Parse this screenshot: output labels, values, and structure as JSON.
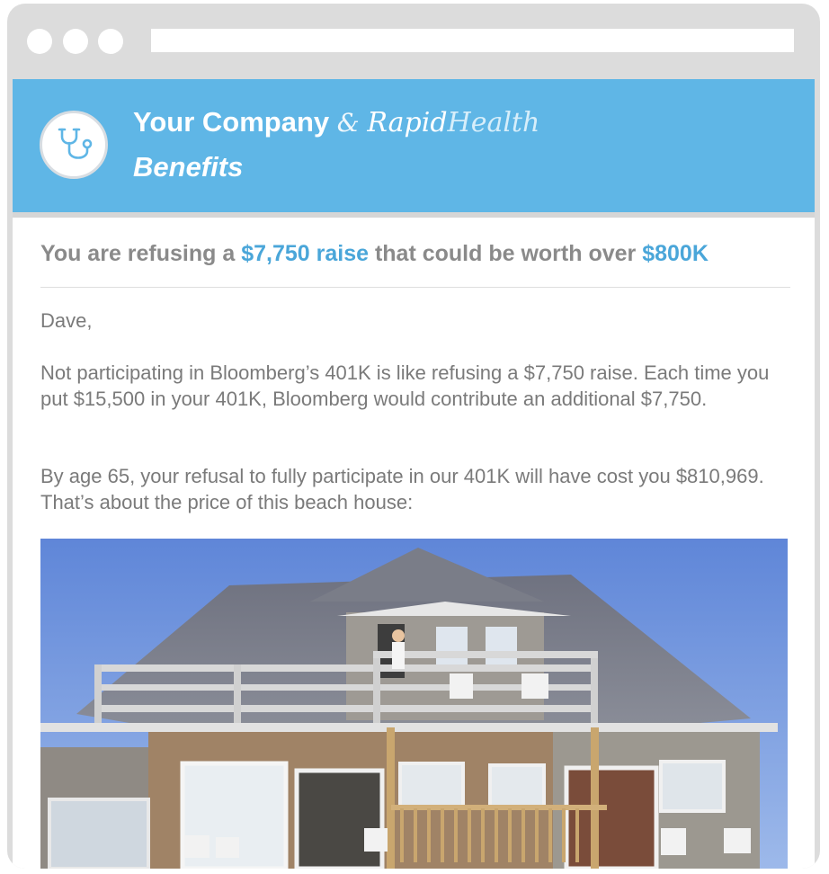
{
  "window": {
    "controls": [
      "close",
      "minimize",
      "maximize"
    ]
  },
  "banner": {
    "logo_icon": "stethoscope-icon",
    "company": "Your Company",
    "ampersand": "&",
    "partner_rapid": "Rapid",
    "partner_health": "Health",
    "subtitle": "Benefits",
    "color": "#5fb6e6"
  },
  "email": {
    "headline_prefix": "You are refusing a ",
    "headline_amount": "$7,750 raise",
    "headline_middle": " that could be worth over ",
    "headline_total": "$800K",
    "greeting": "Dave,",
    "paragraph1": "Not participating in Bloomberg’s 401K is like refusing a $7,750 raise. Each time you put $15,500 in your 401K, Bloomberg would contribute an additional $7,750.",
    "paragraph2": "By age 65, your refusal to fully participate in our 401K will have cost you $810,969. That’s about the price of this beach house:",
    "image": "beach-house-photo",
    "accent_color": "#4aa6d9"
  }
}
